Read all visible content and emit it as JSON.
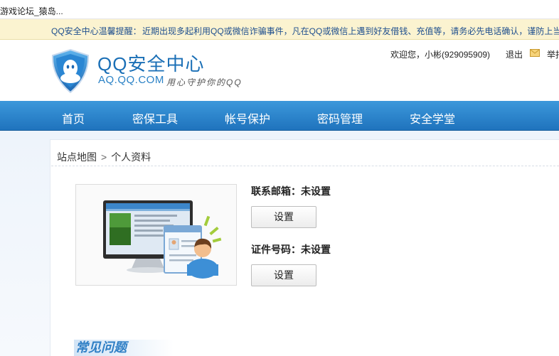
{
  "browser": {
    "tab_title": "游戏论坛_猿岛..."
  },
  "notice": {
    "label": "QQ安全中心温馨提醒：",
    "text": "近期出现多起利用QQ或微信诈骗事件，凡在QQ或微信上遇到好友借钱、充值等，请务必先电话确认，谨防上当受骗！"
  },
  "header": {
    "logo_title": "QQ安全中心",
    "logo_domain": "AQ.QQ.COM",
    "logo_slogan": "用心守护你的QQ",
    "welcome": "欢迎您，小彬(929095909)",
    "logout": "退出",
    "report": "举报"
  },
  "nav": {
    "items": [
      "首页",
      "密保工具",
      "帐号保护",
      "密码管理",
      "安全学堂"
    ]
  },
  "breadcrumb": {
    "home": "站点地图",
    "separator": ">",
    "current": "个人资料"
  },
  "profile": {
    "email_label": "联系邮箱：未设置",
    "email_button": "设置",
    "id_label": "证件号码：未设置",
    "id_button": "设置"
  },
  "faq": {
    "title": "常见问题"
  },
  "colors": {
    "brand_blue": "#1f73bd",
    "notice_bg": "#fbf3d0",
    "text_link": "#1f4f8e"
  }
}
